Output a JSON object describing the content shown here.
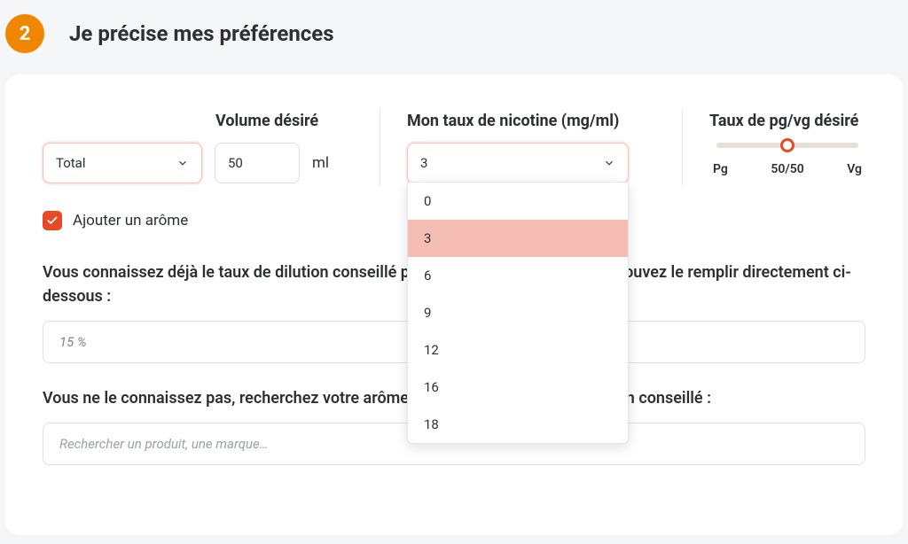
{
  "step": {
    "number": "2",
    "title": "Je précise mes préférences"
  },
  "volume": {
    "label": "Volume désiré",
    "type_selected": "Total",
    "value": "50",
    "unit": "ml"
  },
  "nicotine": {
    "label": "Mon taux de nicotine (mg/ml)",
    "selected": "3",
    "options": [
      "0",
      "3",
      "6",
      "9",
      "12",
      "16",
      "18"
    ]
  },
  "pgvg": {
    "label": "Taux de pg/vg désiré",
    "left": "Pg",
    "center": "50/50",
    "right": "Vg"
  },
  "aroma_checkbox": {
    "label": "Ajouter un arôme",
    "checked": true
  },
  "dilution": {
    "intro": "Vous connaissez déjà le taux de dilution conseillé pour votre base (50/50), vous pouvez le remplir directement ci-dessous :",
    "value": "15 %"
  },
  "search": {
    "intro": "Vous ne le connaissez pas, recherchez votre arôme pour afficher le taux de dilution conseillé :",
    "placeholder": "Rechercher un produit, une marque…"
  }
}
